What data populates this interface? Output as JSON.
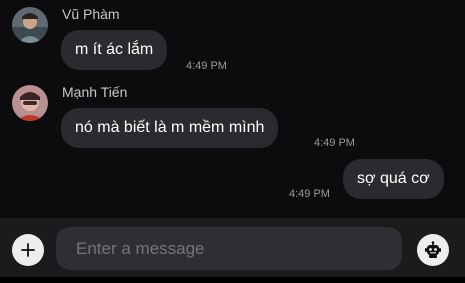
{
  "messages": [
    {
      "sender": "Vũ Phàm",
      "text": "m ít ác lắm",
      "time": "4:49 PM",
      "avatar_icon": "user-avatar-icon"
    },
    {
      "sender": "Mạnh Tiến",
      "text": "nó mà biết là m mềm mình",
      "time": "4:49 PM",
      "avatar_icon": "user-avatar-icon"
    },
    {
      "text": "sợ quá cơ",
      "time": "4:49 PM"
    }
  ],
  "composer": {
    "placeholder": "Enter a message",
    "add_icon": "plus-icon",
    "bot_icon": "bot-icon"
  },
  "colors": {
    "background": "#0c0c0e",
    "bubble": "#2b2b2f",
    "composer_bar": "#1b1b1e",
    "input_field": "#2f2f33",
    "icon_button": "#ededed"
  }
}
